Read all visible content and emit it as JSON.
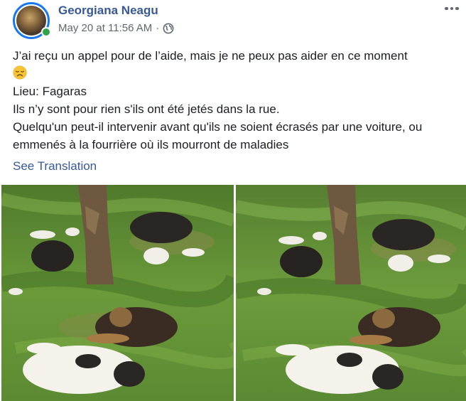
{
  "post": {
    "author": "Georgiana Neagu",
    "timestamp": "May 20 at 11:56 AM",
    "separator": "·",
    "privacy_icon": "globe-icon",
    "more_icon": "more-horizontal-icon",
    "avatar_icon": "profile-photo",
    "online_status_color": "#31a24c",
    "text_lines": [
      "J’ai reçu un appel pour de l’aide, mais je ne peux pas aider en ce moment",
      "Lieu: Fagaras",
      "Ils n’y sont pour rien s'ils ont été jetés dans la rue.",
      "Quelqu'un peut-il intervenir avant qu'ils ne soient écrasés par une voiture, ou",
      "emmenés à la fourrière où ils mourront de maladies"
    ],
    "emoji_icon": "disappointed-face-emoji",
    "see_translation": "See Translation",
    "photos": [
      {
        "icon": "dogs-under-tree-photo-1"
      },
      {
        "icon": "dogs-under-tree-photo-2"
      }
    ]
  },
  "colors": {
    "name_link": "#385898",
    "meta_text": "#606770",
    "body_text": "#1c1e21",
    "avatar_ring": "#1877f2"
  }
}
